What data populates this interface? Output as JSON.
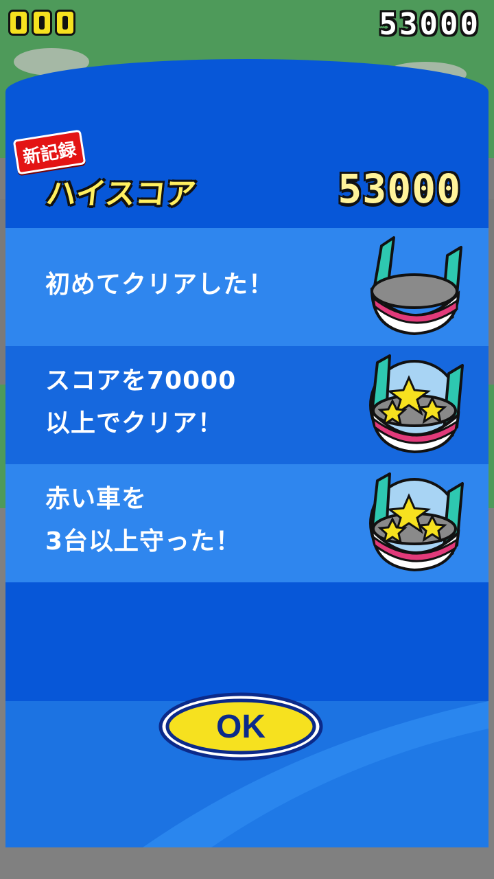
{
  "hud": {
    "lives_count": 3,
    "score": "53000"
  },
  "result": {
    "new_record_label": "新記録",
    "high_score_label": "ハイスコア",
    "high_score_value": "53000"
  },
  "missions": [
    {
      "text": "初めてクリアした！",
      "badge": "empty-badge-icon",
      "achieved": false
    },
    {
      "text": "スコアを70000\n以上でクリア！",
      "badge": "star-badge-icon",
      "achieved": true
    },
    {
      "text": "赤い車を\n3台以上守った！",
      "badge": "star-badge-icon",
      "achieved": true
    }
  ],
  "ok_button": {
    "label": "OK"
  },
  "colors": {
    "panel": "#0757d8",
    "row_light": "#2f86ee",
    "row_dark": "#1668de",
    "gold": "#f6e11f",
    "record_red": "#e31414",
    "badge_teal": "#2ec8b0"
  }
}
